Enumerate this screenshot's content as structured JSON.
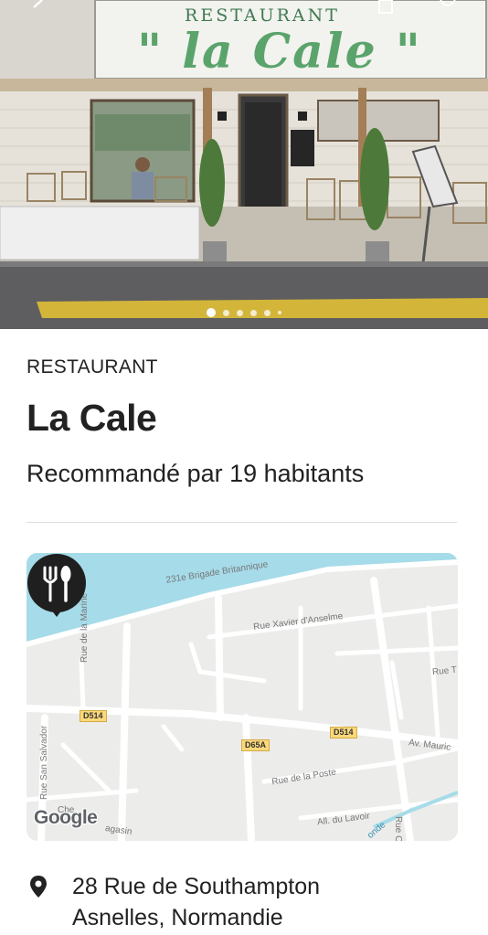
{
  "hero": {
    "sign_top": "RESTAURANT",
    "sign_main": "\" la Cale \"",
    "icons": [
      "back-arrow-icon",
      "share-icon",
      "heart-icon"
    ],
    "photo_count": 6,
    "active_photo": 1
  },
  "place": {
    "category": "RESTAURANT",
    "name": "La Cale",
    "recommendation": "Recommandé par 19 habitants"
  },
  "map": {
    "streets": {
      "brigade": "231e Brigade Britannique",
      "xavier": "Rue Xavier d'Anselme",
      "marine": "Rue de la Marine",
      "salvador": "Rue San Salvador",
      "poste": "Rue de la Poste",
      "lavoir": "All. du Lavoir",
      "maurice": "Av. Mauric",
      "rue_t": "Rue T",
      "rue_c": "Rue C",
      "che": "Che",
      "agasin": "agasin",
      "onde": "onde"
    },
    "road_badges": [
      "D514",
      "D514",
      "D65A"
    ],
    "attribution": "Google",
    "pin_icon": "fork-knife-icon"
  },
  "address": {
    "icon": "location-pin-icon",
    "line1": "28 Rue de Southampton",
    "line2": "Asnelles, Normandie"
  },
  "colors": {
    "sea": "#a6dbe9",
    "road_badge": "#fbd87a",
    "pin": "#1f1f1f"
  }
}
